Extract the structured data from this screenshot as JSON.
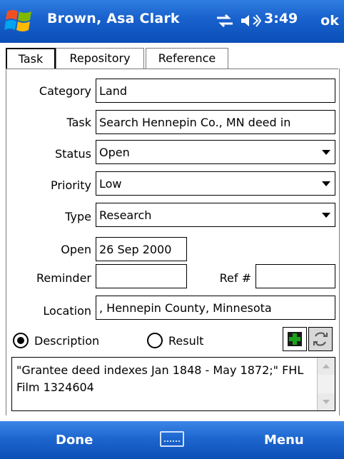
{
  "titlebar": {
    "title": "Brown, Asa Clark",
    "clock": "3:49",
    "ok_label": "ok",
    "status_icons": [
      "connectivity-icon",
      "speaker-icon"
    ]
  },
  "tabs": [
    {
      "label": "Task",
      "active": true
    },
    {
      "label": "Repository",
      "active": false
    },
    {
      "label": "Reference",
      "active": false
    }
  ],
  "form": {
    "category_label": "Category",
    "category_value": "Land",
    "task_label": "Task",
    "task_value": "Search Hennepin Co., MN deed in",
    "status_label": "Status",
    "status_value": "Open",
    "priority_label": "Priority",
    "priority_value": "Low",
    "type_label": "Type",
    "type_value": "Research",
    "open_label": "Open",
    "open_value": "26 Sep 2000",
    "reminder_label": "Reminder",
    "reminder_value": "",
    "ref_label": "Ref #",
    "ref_value": "",
    "location_label": "Location",
    "location_value": ", Hennepin County, Minnesota"
  },
  "notes": {
    "description_label": "Description",
    "result_label": "Result",
    "selected": "Description",
    "text": "\"Grantee deed indexes Jan 1848 - May 1872;\" FHL Film 1324604"
  },
  "bottom_bar": {
    "left_label": "Done",
    "right_label": "Menu",
    "center_icon": "keyboard-icon"
  },
  "colors": {
    "bar_blue": "#1860cc",
    "accent_green": "#1aa31a"
  }
}
